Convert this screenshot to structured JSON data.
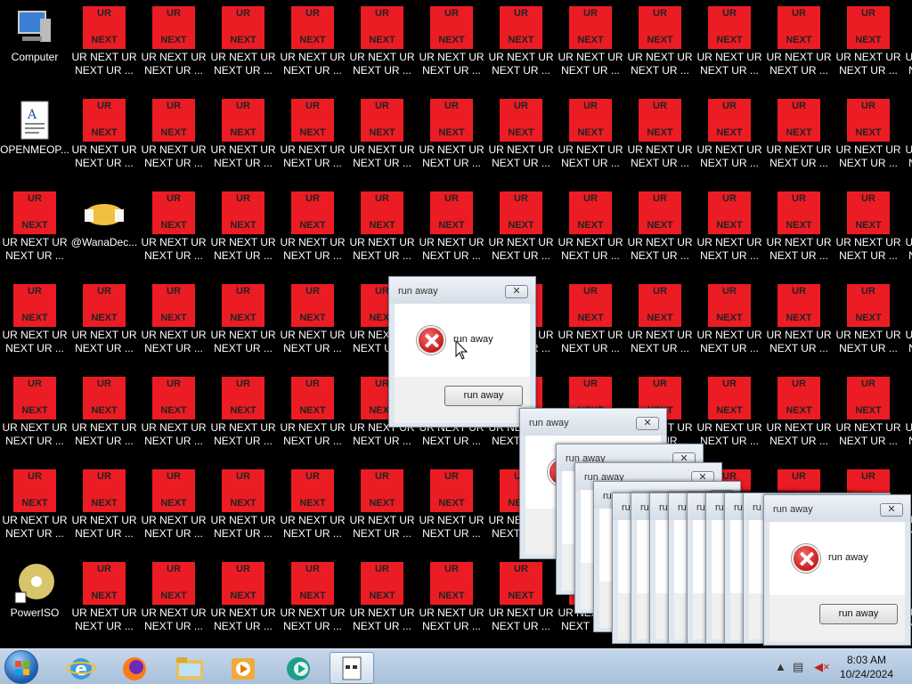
{
  "desktop_icons": {
    "computer": "Computer",
    "openmeop": "OPENMEOP...",
    "wanadec": "@WanaDec...",
    "poweriso": "PowerISO",
    "ur_next_label": "UR NEXT UR NEXT UR ...",
    "ur_top": "UR",
    "ur_bottom": "NEXT"
  },
  "dialog": {
    "title": "run away",
    "message": "run away",
    "button": "run away",
    "close_glyph": "✕"
  },
  "dialog_partial_title": "ru",
  "taskbar": {
    "time": "8:03 AM",
    "date": "10/24/2024"
  },
  "colors": {
    "ur_red": "#ec1c24",
    "taskbar": "#b7cbe2"
  }
}
